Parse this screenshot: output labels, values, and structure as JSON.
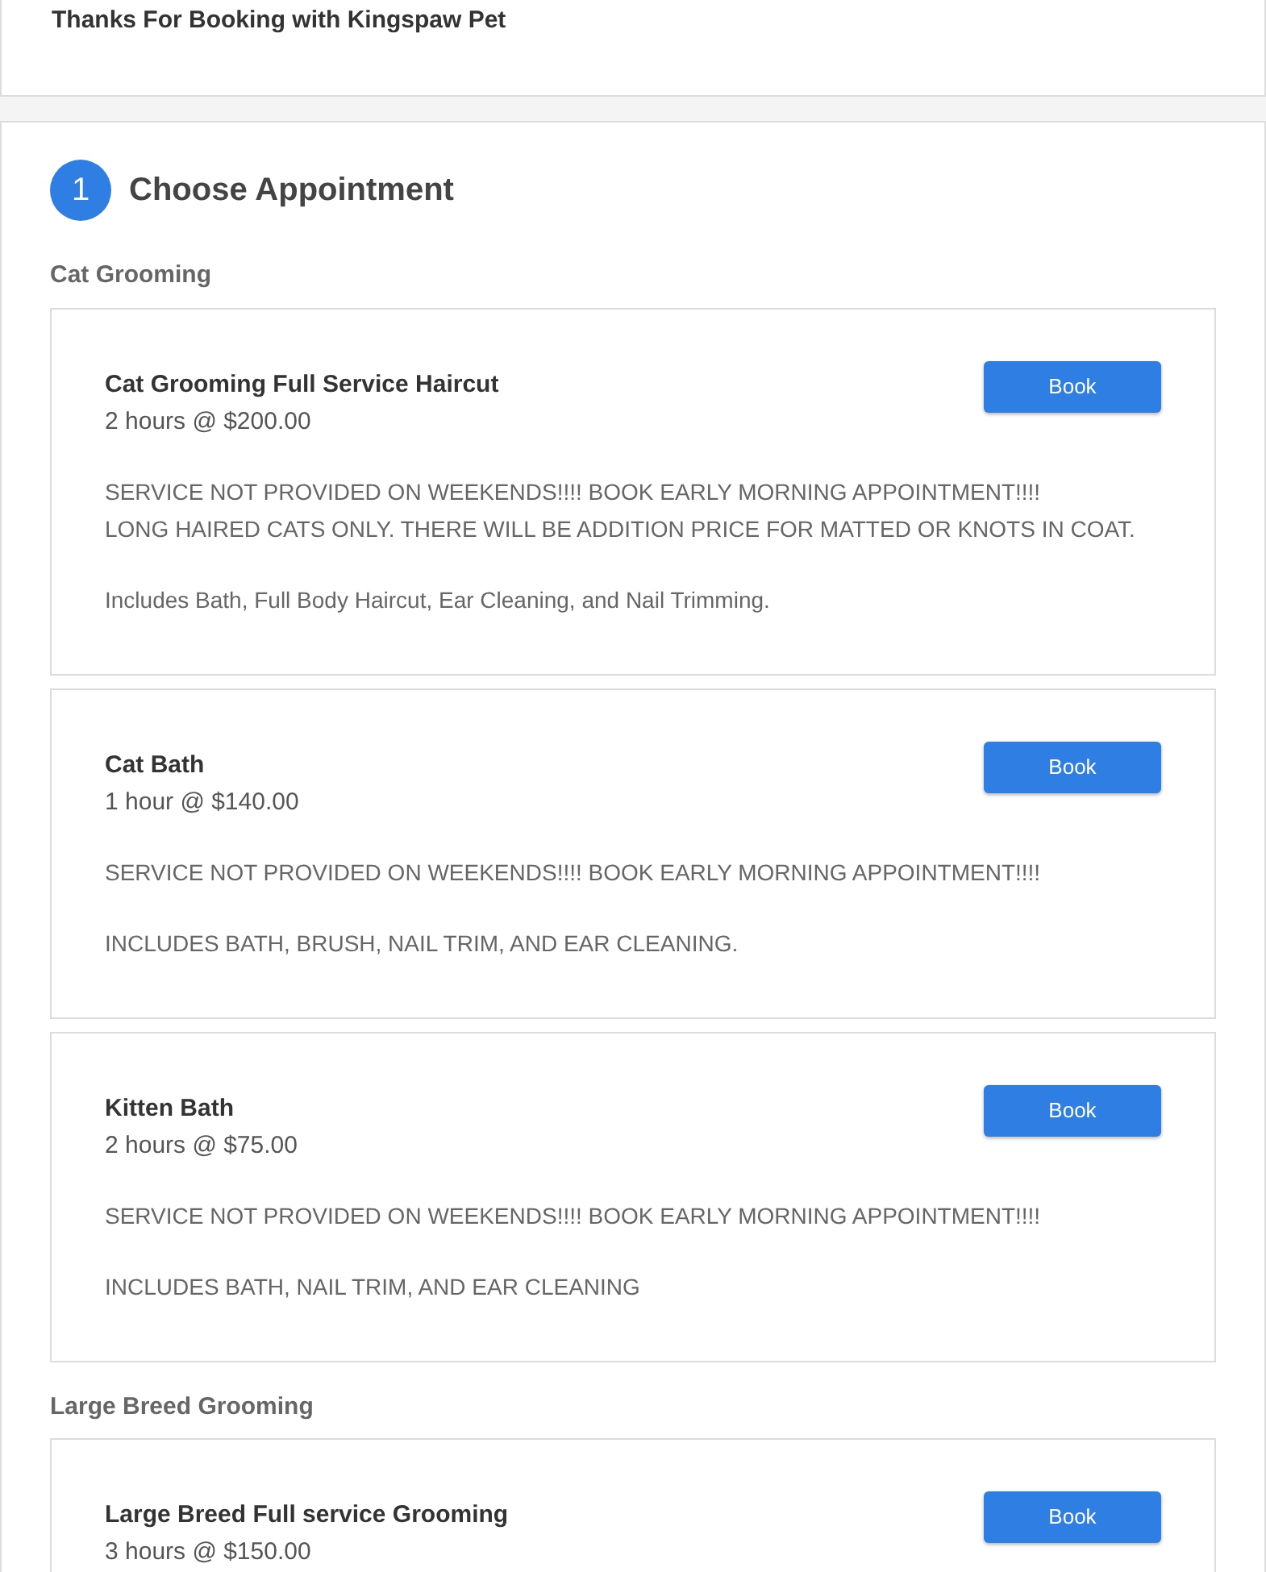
{
  "confirmation": {
    "message": "Thanks For Booking with Kingspaw Pet"
  },
  "step": {
    "number": "1",
    "title": "Choose Appointment"
  },
  "categories": [
    {
      "name": "Cat Grooming",
      "services": [
        {
          "name": "Cat Grooming Full Service Haircut",
          "price": "2 hours @ $200.00",
          "button": "Book",
          "paragraphs": [
            [
              "SERVICE NOT PROVIDED ON WEEKENDS!!!! BOOK EARLY MORNING APPOINTMENT!!!!",
              "LONG HAIRED CATS ONLY. THERE WILL BE ADDITION PRICE FOR MATTED OR KNOTS IN COAT."
            ],
            [
              "Includes Bath, Full Body Haircut, Ear Cleaning, and Nail Trimming."
            ]
          ]
        },
        {
          "name": "Cat Bath",
          "price": "1 hour @ $140.00",
          "button": "Book",
          "paragraphs": [
            [
              "SERVICE NOT PROVIDED ON WEEKENDS!!!! BOOK EARLY MORNING APPOINTMENT!!!!"
            ],
            [
              "INCLUDES BATH, BRUSH, NAIL TRIM, AND EAR CLEANING."
            ]
          ]
        },
        {
          "name": "Kitten Bath",
          "price": "2 hours @ $75.00",
          "button": "Book",
          "paragraphs": [
            [
              "SERVICE NOT PROVIDED ON WEEKENDS!!!! BOOK EARLY MORNING APPOINTMENT!!!!"
            ],
            [
              "INCLUDES BATH, NAIL TRIM, AND EAR CLEANING"
            ]
          ]
        }
      ]
    },
    {
      "name": "Large Breed Grooming",
      "services": [
        {
          "name": "Large Breed Full service Grooming",
          "price": "3 hours @ $150.00",
          "button": "Book"
        }
      ]
    }
  ]
}
